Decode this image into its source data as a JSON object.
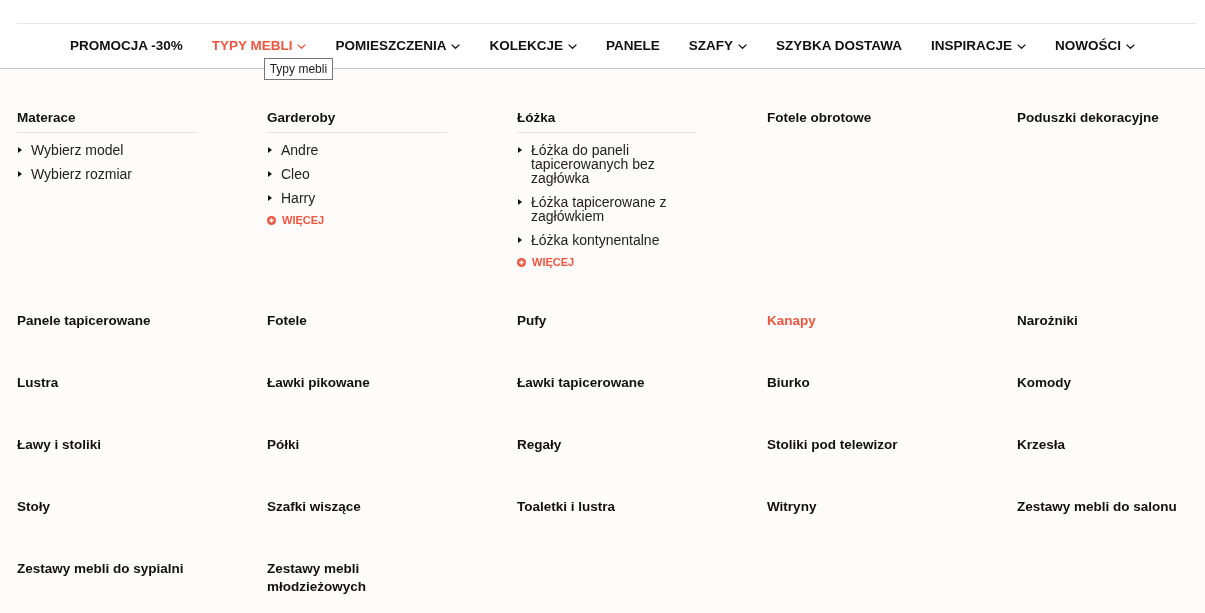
{
  "nav": {
    "items": [
      {
        "label": "PROMOCJA -30%",
        "dropdown": false,
        "selected": false
      },
      {
        "label": "TYPY MEBLI",
        "dropdown": true,
        "selected": true,
        "tooltip": "Typy mebli"
      },
      {
        "label": "POMIESZCZENIA",
        "dropdown": true,
        "selected": false
      },
      {
        "label": "KOLEKCJE",
        "dropdown": true,
        "selected": false
      },
      {
        "label": "PANELE",
        "dropdown": false,
        "selected": false
      },
      {
        "label": "SZAFY",
        "dropdown": true,
        "selected": false
      },
      {
        "label": "SZYBKA DOSTAWA",
        "dropdown": false,
        "selected": false
      },
      {
        "label": "INSPIRACJE",
        "dropdown": true,
        "selected": false
      },
      {
        "label": "NOWOŚCI",
        "dropdown": true,
        "selected": false
      }
    ]
  },
  "mega_menu": {
    "categories": [
      {
        "title": "Materace",
        "selected": false,
        "children": [
          {
            "label": "Wybierz model"
          },
          {
            "label": "Wybierz rozmiar"
          }
        ]
      },
      {
        "title": "Garderoby",
        "selected": false,
        "children": [
          {
            "label": "Andre"
          },
          {
            "label": "Cleo"
          },
          {
            "label": "Harry"
          }
        ],
        "more": "WIĘCEJ"
      },
      {
        "title": "Łóżka",
        "selected": false,
        "children": [
          {
            "label": "Łóżka do paneli tapicerowanych bez zagłówka"
          },
          {
            "label": "Łóżka tapicerowane z zagłówkiem"
          },
          {
            "label": "Łóżka kontynentalne"
          }
        ],
        "more": "WIĘCEJ"
      },
      {
        "title": "Fotele obrotowe",
        "selected": false
      },
      {
        "title": "Poduszki dekoracyjne",
        "selected": false
      },
      {
        "title": "Panele tapicerowane",
        "selected": false
      },
      {
        "title": "Fotele",
        "selected": false
      },
      {
        "title": "Pufy",
        "selected": false
      },
      {
        "title": "Kanapy",
        "selected": true
      },
      {
        "title": "Narożniki",
        "selected": false
      },
      {
        "title": "Lustra",
        "selected": false
      },
      {
        "title": "Ławki pikowane",
        "selected": false
      },
      {
        "title": "Ławki tapicerowane",
        "selected": false
      },
      {
        "title": "Biurko",
        "selected": false
      },
      {
        "title": "Komody",
        "selected": false
      },
      {
        "title": "Ławy i stoliki",
        "selected": false
      },
      {
        "title": "Półki",
        "selected": false
      },
      {
        "title": "Regały",
        "selected": false
      },
      {
        "title": "Stoliki pod telewizor",
        "selected": false
      },
      {
        "title": "Krzesła",
        "selected": false
      },
      {
        "title": "Stoły",
        "selected": false
      },
      {
        "title": "Szafki wiszące",
        "selected": false
      },
      {
        "title": "Toaletki i lustra",
        "selected": false
      },
      {
        "title": "Witryny",
        "selected": false
      },
      {
        "title": "Zestawy mebli do salonu",
        "selected": false
      },
      {
        "title": "Zestawy mebli do sypialni",
        "selected": false
      },
      {
        "title": "Zestawy mebli młodzieżowych",
        "selected": false
      }
    ]
  }
}
